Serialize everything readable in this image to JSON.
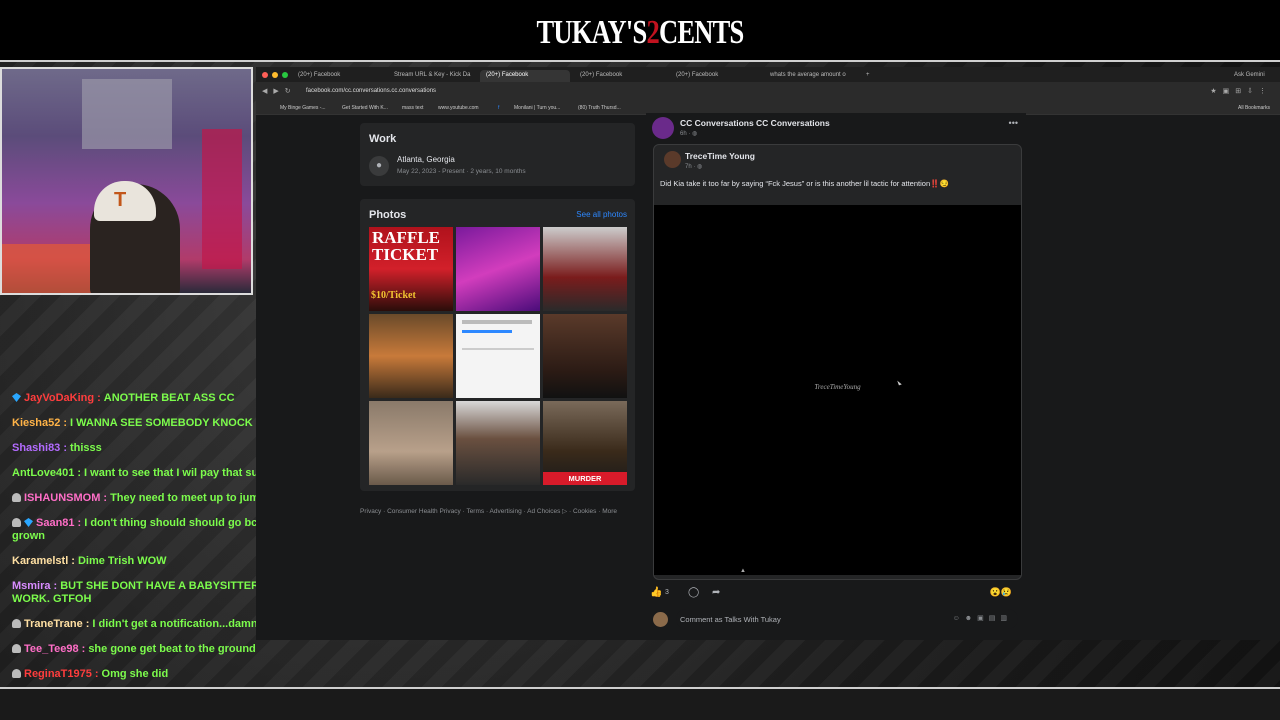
{
  "stream": {
    "brand_prefix": "TUKAY'S",
    "brand_number": "2",
    "brand_suffix": "CENTS"
  },
  "browser": {
    "tabs": [
      {
        "label": "(20+) Facebook"
      },
      {
        "label": "Stream URL & Key - Kick Da"
      },
      {
        "label": "(20+) Facebook"
      },
      {
        "label": "(20+) Facebook"
      },
      {
        "label": "(20+) Facebook"
      },
      {
        "label": "whats the average amount o"
      }
    ],
    "new_tab": "+",
    "ask_label": "Ask Gemini",
    "url": "facebook.com/cc.conversations.cc.conversations",
    "bookmarks": [
      {
        "label": "My Binge Games -..."
      },
      {
        "label": "Get Started With K..."
      },
      {
        "label": "mass text"
      },
      {
        "label": "www.youtube.com"
      },
      {
        "label": ""
      },
      {
        "label": "Monilani | Turn you..."
      },
      {
        "label": "(80) Truth Thursd..."
      }
    ],
    "all_bookmarks": "All Bookmarks"
  },
  "profile": {
    "work": {
      "title": "Work",
      "place": "Atlanta, Georgia",
      "date": "May 22, 2023 - Present · 2 years, 10 months"
    },
    "photos": {
      "title": "Photos",
      "see_all": "See all photos",
      "raffle_title": "RAFFLE TICKET",
      "raffle_price": "$10/Ticket",
      "last_banner": "MURDER SENTENCING"
    },
    "footer": "Privacy · Consumer Health Privacy · Terms · Advertising · Ad Choices ▷ · Cookies · More"
  },
  "post": {
    "group_name": "CC Conversations CC Conversations",
    "group_time": "6h · ",
    "menu": "•••",
    "author": "TreceTime Young",
    "author_time": "7h · ",
    "text": "Did Kia take it too far by saying “Fck Jesus” or is this another lil tactic for attention‼️😏",
    "watermark": "TreceTimeYoung",
    "like_count": "3",
    "comment_placeholder": "Comment as Talks With Tukay",
    "reactions": "😮😢"
  },
  "chat": [
    {
      "user": "JayVoDaKing",
      "text": "ANOTHER BEAT ASS CC",
      "color": "#ff3d3d",
      "badges": [
        "gem"
      ]
    },
    {
      "user": "Kiesha52",
      "text": "I WANNA SEE SOMEBODY KNOCK HER THE FUCK OUT!",
      "color": "#ffb347",
      "badges": []
    },
    {
      "user": "Shashi83",
      "text": "thisss",
      "color": "#b36bff",
      "badges": []
    },
    {
      "user": "AntLove401",
      "text": "I want to see that I wil pay that subscription",
      "color": "#7CFC4C",
      "badges": []
    },
    {
      "user": "ISHAUNSMOM",
      "text": "They need to meet up to jump that hoe!!!!",
      "color": "#ff6ec7",
      "badges": [
        "mic"
      ]
    },
    {
      "user": "Saan81",
      "text": "I don't thing should should go bc she not mentally grown",
      "color": "#ff6ec7",
      "badges": [
        "mic",
        "gem"
      ]
    },
    {
      "user": "Karamelstl",
      "text": "Dime Trish WOW",
      "color": "#ffe0a3",
      "badges": []
    },
    {
      "user": "Msmira",
      "text": "BUT SHE DONT HAVE A BABYSITTER SO SHE CAN WORK. GTFOH",
      "color": "#d98cff",
      "badges": []
    },
    {
      "user": "TraneTrane",
      "text": "I didn't get a notification...damn",
      "color": "#ffe0a3",
      "badges": [
        "mic"
      ]
    },
    {
      "user": "Tee_Tee98",
      "text": "she gone get beat to the ground",
      "color": "#ff6ec7",
      "badges": [
        "mic"
      ]
    },
    {
      "user": "ReginaT1975",
      "text": "Omg she did",
      "color": "#ff3d3d",
      "badges": [
        "mic"
      ]
    }
  ]
}
